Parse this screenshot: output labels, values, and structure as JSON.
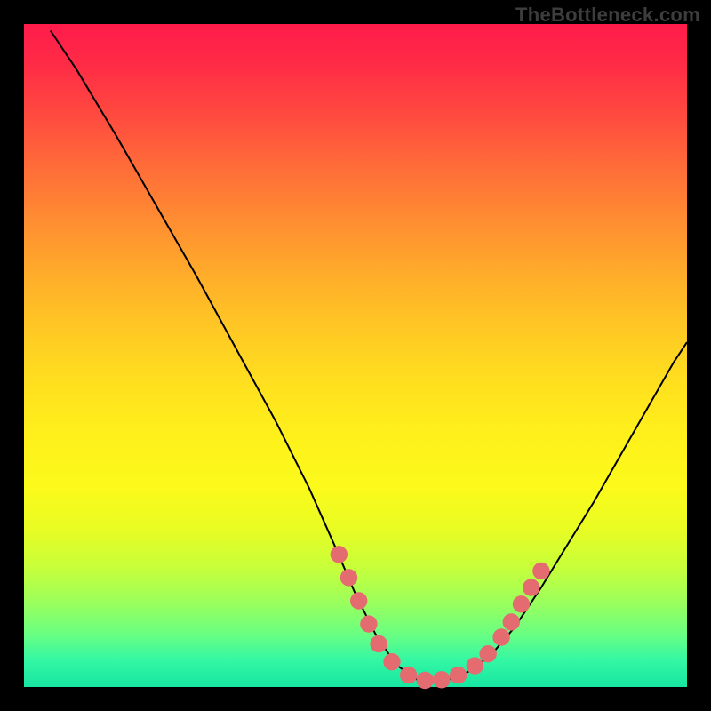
{
  "watermark": "TheBottleneck.com",
  "chart_data": {
    "type": "line",
    "title": "",
    "xlabel": "",
    "ylabel": "",
    "xlim": [
      0,
      100
    ],
    "ylim": [
      0,
      100
    ],
    "gradient_note": "background vertical gradient red(top)->yellow->green(bottom) indicating bottleneck severity low at bottom",
    "curve": {
      "description": "V-shaped bottleneck curve; minimum near x≈60",
      "points_pct": [
        {
          "x": 4.0,
          "y": 99.0
        },
        {
          "x": 8.0,
          "y": 93.0
        },
        {
          "x": 14.0,
          "y": 83.0
        },
        {
          "x": 20.0,
          "y": 72.5
        },
        {
          "x": 26.0,
          "y": 62.0
        },
        {
          "x": 32.0,
          "y": 51.0
        },
        {
          "x": 38.0,
          "y": 40.0
        },
        {
          "x": 43.0,
          "y": 30.0
        },
        {
          "x": 47.0,
          "y": 21.0
        },
        {
          "x": 50.0,
          "y": 14.0
        },
        {
          "x": 53.0,
          "y": 8.0
        },
        {
          "x": 56.0,
          "y": 3.5
        },
        {
          "x": 59.0,
          "y": 1.2
        },
        {
          "x": 62.0,
          "y": 0.8
        },
        {
          "x": 65.0,
          "y": 1.3
        },
        {
          "x": 68.0,
          "y": 2.8
        },
        {
          "x": 71.0,
          "y": 5.5
        },
        {
          "x": 74.0,
          "y": 9.0
        },
        {
          "x": 78.0,
          "y": 15.0
        },
        {
          "x": 82.0,
          "y": 21.5
        },
        {
          "x": 86.0,
          "y": 28.0
        },
        {
          "x": 90.0,
          "y": 35.0
        },
        {
          "x": 94.0,
          "y": 42.0
        },
        {
          "x": 98.0,
          "y": 49.0
        },
        {
          "x": 100.0,
          "y": 52.0
        }
      ]
    },
    "highlight_dots_pct": [
      {
        "x": 47.5,
        "y": 20.0
      },
      {
        "x": 49.0,
        "y": 16.5
      },
      {
        "x": 50.5,
        "y": 13.0
      },
      {
        "x": 52.0,
        "y": 9.5
      },
      {
        "x": 53.5,
        "y": 6.5
      },
      {
        "x": 55.5,
        "y": 3.8
      },
      {
        "x": 58.0,
        "y": 1.8
      },
      {
        "x": 60.5,
        "y": 1.0
      },
      {
        "x": 63.0,
        "y": 1.1
      },
      {
        "x": 65.5,
        "y": 1.8
      },
      {
        "x": 68.0,
        "y": 3.2
      },
      {
        "x": 70.0,
        "y": 5.0
      },
      {
        "x": 72.0,
        "y": 7.5
      },
      {
        "x": 73.5,
        "y": 9.8
      },
      {
        "x": 75.0,
        "y": 12.5
      },
      {
        "x": 76.5,
        "y": 15.0
      },
      {
        "x": 78.0,
        "y": 17.5
      }
    ],
    "highlight_dot_radius_pct": 1.3
  }
}
